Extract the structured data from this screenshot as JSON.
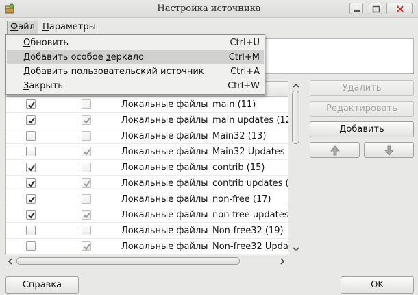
{
  "window": {
    "title": "Настройка источника"
  },
  "menubar": {
    "file": {
      "label": "Файл",
      "mnemonic": "Ф",
      "rest": "айл"
    },
    "params": {
      "label": "Параметры",
      "mnemonic": "П",
      "rest": "араметры"
    }
  },
  "file_menu": {
    "items": [
      {
        "pre": "",
        "mn": "О",
        "post": "бновить",
        "shortcut": "Ctrl+U",
        "highlighted": false
      },
      {
        "pre": "Добавить особое ",
        "mn": "з",
        "post": "еркало",
        "shortcut": "Ctrl+M",
        "highlighted": true
      },
      {
        "pre": "",
        "mn": "Д",
        "post": "обавить пользовательский источник",
        "shortcut": "Ctrl+A",
        "highlighted": false
      },
      {
        "pre": "",
        "mn": "З",
        "post": "акрыть",
        "shortcut": "Ctrl+W",
        "highlighted": false
      }
    ]
  },
  "sources": {
    "rows": [
      {
        "enabled": true,
        "updates": false,
        "source": "Локальные файлы",
        "name": "main (11)"
      },
      {
        "enabled": true,
        "updates": true,
        "source": "Локальные файлы",
        "name": "main updates (12"
      },
      {
        "enabled": false,
        "updates": false,
        "source": "Локальные файлы",
        "name": "Main32 (13)"
      },
      {
        "enabled": false,
        "updates": true,
        "source": "Локальные файлы",
        "name": "Main32 Updates ("
      },
      {
        "enabled": true,
        "updates": false,
        "source": "Локальные файлы",
        "name": "contrib (15)"
      },
      {
        "enabled": true,
        "updates": true,
        "source": "Локальные файлы",
        "name": "contrib updates ("
      },
      {
        "enabled": true,
        "updates": false,
        "source": "Локальные файлы",
        "name": "non-free (17)"
      },
      {
        "enabled": true,
        "updates": true,
        "source": "Локальные файлы",
        "name": "non-free updates"
      },
      {
        "enabled": false,
        "updates": false,
        "source": "Локальные файлы",
        "name": "Non-free32 (19)"
      },
      {
        "enabled": false,
        "updates": true,
        "source": "Локальные файлы",
        "name": "Non-free32 Upda"
      }
    ]
  },
  "actions": {
    "remove": "Удалить",
    "edit": "Редактировать",
    "add": "Добавить"
  },
  "footer": {
    "help": "Справка",
    "ok": "OK"
  },
  "icons": {
    "app": "package-icon",
    "up": "arrow-up-icon",
    "down": "arrow-down-icon"
  }
}
